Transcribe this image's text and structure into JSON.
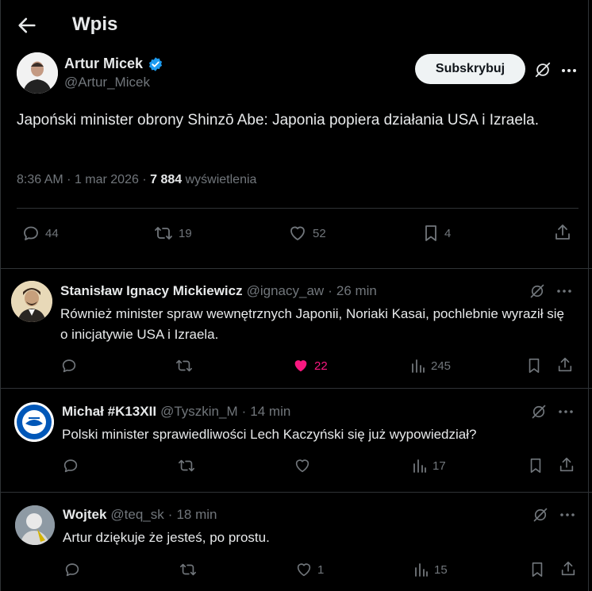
{
  "header": {
    "title": "Wpis"
  },
  "main_post": {
    "author_name": "Artur Micek",
    "handle": "@Artur_Micek",
    "subscribe_label": "Subskrybuj",
    "text": "Japoński minister obrony Shinzō Abe: Japonia popiera działania USA i Izraela.",
    "time": "8:36 AM",
    "date": "1 mar 2026",
    "views_count": "7 884",
    "views_label": "wyświetlenia",
    "replies": "44",
    "reposts": "19",
    "likes": "52",
    "bookmarks": "4"
  },
  "replies": [
    {
      "name": "Stanisław Ignacy Mickiewicz",
      "handle": "@ignacy_aw",
      "time": "26 min",
      "text": "Również minister spraw wewnętrznych Japonii, Noriaki Kasai, pochlebnie wyraził się o inicjatywie USA i Izraela.",
      "likes": "22",
      "views": "245"
    },
    {
      "name": "Michał #K13XII",
      "handle": "@Tyszkin_M",
      "time": "14 min",
      "text": "Polski minister sprawiedliwości Lech Kaczyński się już wypowiedział?",
      "views": "17"
    },
    {
      "name": "Wojtek",
      "handle": "@teq_sk",
      "time": "18 min",
      "text": "Artur dziękuje że jesteś, po prostu.",
      "likes": "1",
      "views": "15"
    }
  ],
  "separator": "·",
  "colors": {
    "verified": "#1d9bf0",
    "liked": "#f91880",
    "muted": "#71767b",
    "border": "#2f3336"
  }
}
